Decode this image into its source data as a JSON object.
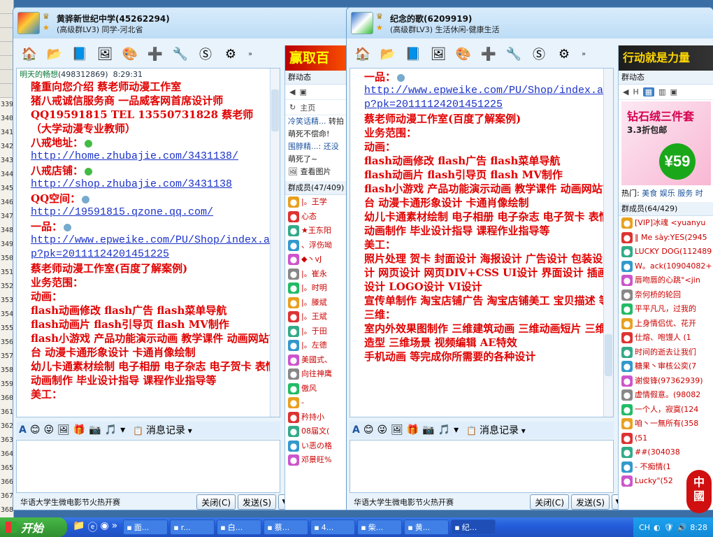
{
  "background_app": {
    "line_numbers": [
      "339",
      "340",
      "341",
      "342",
      "343",
      "344",
      "345",
      "346",
      "347",
      "348",
      "349",
      "350",
      "351",
      "352",
      "353",
      "354",
      "355",
      "356",
      "357",
      "358",
      "359",
      "360",
      "361",
      "362",
      "363",
      "364",
      "365",
      "366",
      "367",
      "368"
    ]
  },
  "win1": {
    "title": "黄骅新世纪中学(45262294)",
    "subtitle": "(高级群LV3) 同学-河北省",
    "banner": "赢取百",
    "sender_name": "明天的畅想",
    "sender_id": "(498312869)",
    "sender_time": "8:29:31",
    "lines": [
      "隆重向您介绍   蔡老师动漫工作室",
      "猪八戒诚信服务商   一品威客网首席设计师",
      "QQ19591815   TEL 13550731828 蔡老师",
      "（大学动漫专业教师）",
      "八戒地址："
    ],
    "link1": "http://home.zhubajie.com/3431138/",
    "shop_label": "八戒店铺：",
    "link2": "http://shop.zhubajie.com/3431138",
    "qzone_label": "QQ空间：",
    "link3": "http://19591815.qzone.qq.com/",
    "yipin_label": "一品：",
    "link4": "http://www.epweike.com/PU/Shop/index.asp?pk=20111124201451225",
    "lines2": [
      "蔡老师动漫工作室(百度了解案例)",
      "业务范围：",
      "动画：",
      "flash动画修改 flash广告 flash菜单导航",
      "flash动画片 flash引导页 flash MV制作",
      "flash小游戏 产品功能演示动画 教学课件 动画网站前台 动漫卡通形象设计 卡通肖像绘制",
      "幼儿卡通素材绘制 电子相册 电子杂志 电子贺卡 表情动画制作 毕业设计指导  课程作业指导等",
      "美工："
    ],
    "fmt_record": "消息记录",
    "ad_text": "华语大学生微电影节火热开赛",
    "close_btn": "关闭(C)",
    "send_btn": "发送(S)",
    "side": {
      "group_news": "群动态",
      "home": "主页",
      "feed1": "冷笑话精...",
      "feed1b": "转拍",
      "feed2": "萌死不偿命!",
      "feed3": "围脖精...: 还没",
      "feed4": "萌死了~",
      "view_pics": "查看图片",
      "members_hdr": "群成员(47/409)",
      "members": [
        "|。王学",
        "心态",
        "★王东阳",
        "、浮伤呦",
        "◆丶vJ",
        "|。崔永",
        "|。时明",
        "|。滕斌",
        "|。王斌",
        "|。于田",
        "|。左德",
        "美國式、",
        "向往神鹰",
        "傲风",
        "-",
        "矜持小",
        "08届文(",
        "い恶の格",
        "邓景旺%"
      ]
    }
  },
  "win2": {
    "title": "纪念的歌(6209919)",
    "subtitle": "(高级群LV3) 生活休闲-健康生活",
    "banner": "行动就是力量",
    "yipin_label": "一品：",
    "link4": "http://www.epweike.com/PU/Shop/index.asp?pk=20111124201451225",
    "lines": [
      "蔡老师动漫工作室(百度了解案例)",
      "业务范围：",
      "动画：",
      "flash动画修改 flash广告 flash菜单导航",
      "flash动画片 flash引导页 flash MV制作",
      "flash小游戏 产品功能演示动画 教学课件 动画网站前台 动漫卡通形象设计 卡通肖像绘制",
      "幼儿卡通素材绘制 电子相册 电子杂志 电子贺卡 表情动画制作 毕业设计指导  课程作业指导等",
      "美工：",
      "照片处理  贺卡 封面设计 海报设计 广告设计 包装设计 网页设计 网页DIV+CSS  UI设计  界面设计 插画设计 LOGO设计 VI设计",
      "宣传单制作 淘宝店铺广告  淘宝店铺美工 宝贝描述 等",
      "三维：",
      "室内外效果图制作 三维建筑动画 三维动画短片 三维造型 三维场景 视频编辑   AE特效",
      "手机动画 等完成你所需要的各种设计"
    ],
    "fmt_record": "消息记录",
    "ad_text": "华语大学生微电影节火热开赛",
    "close_btn": "关闭(C)",
    "send_btn": "发送(S)",
    "side": {
      "group_news": "群动态",
      "shop_t1": "钻石绒三件套",
      "shop_t2": "3.3折包邮",
      "shop_price": "¥59",
      "hot_label": "热门:",
      "hot_links": [
        "美食",
        "娱乐",
        "服务",
        "时"
      ],
      "members_hdr": "群成员(64/429)",
      "members": [
        "[VIP]冰魂 <yuanyu",
        "‖ Me sày:YES(2945",
        "LUCKY DOG(112489",
        "W。ack(10904082+",
        "唇吻唇的心跳°<jin",
        "奈何桥的轮回",
        "平平凡凡，过我的",
        "上身情侣优、花开",
        "仕熔、咆馒人  (1",
        "时间的逝去让我们",
        "糖果丶审核公奕(7",
        "谢俊锋(97362939)",
        "虚情假意。(98082",
        "一个人，寂寞(124",
        "咱丶一無所有(358",
        "(51",
        "##(304038",
        "- 不痴情(1",
        "Lucky\"(52"
      ]
    }
  },
  "taskbar": {
    "start": "开始",
    "tasks": [
      "面...",
      "r...",
      "白...",
      "蔡...",
      "4...",
      "柴...",
      "黄...",
      "纪..."
    ],
    "ime": "CH",
    "time": "8:28"
  },
  "stamp": "中国"
}
